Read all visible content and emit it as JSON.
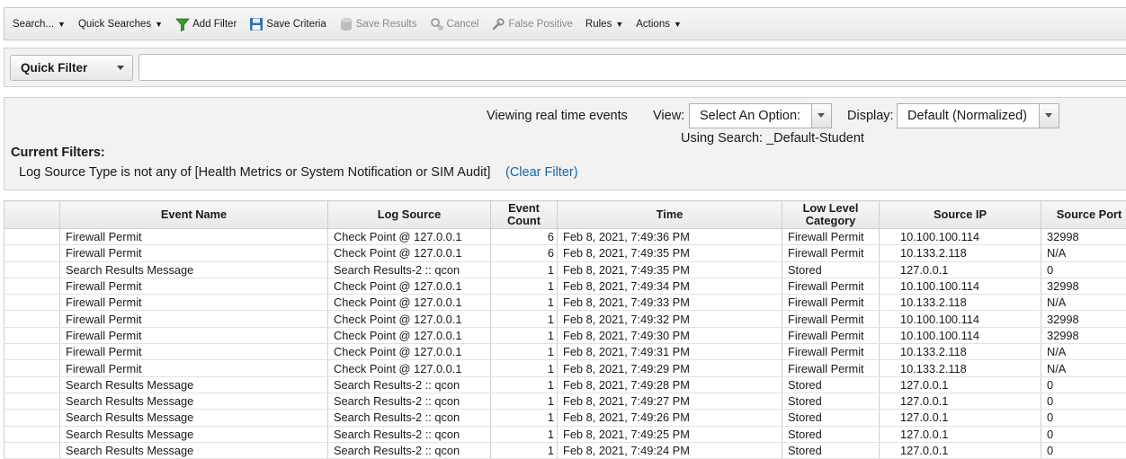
{
  "toolbar": {
    "items": [
      {
        "label": "Search...",
        "dropdown": true,
        "icon": "",
        "disabled": false
      },
      {
        "label": "Quick Searches",
        "dropdown": true,
        "icon": "",
        "disabled": false
      },
      {
        "label": "Add Filter",
        "dropdown": false,
        "icon": "funnel-icon",
        "disabled": false
      },
      {
        "label": "Save Criteria",
        "dropdown": false,
        "icon": "floppy-disk-icon",
        "disabled": false
      },
      {
        "label": "Save Results",
        "dropdown": false,
        "icon": "database-icon",
        "disabled": true
      },
      {
        "label": "Cancel",
        "dropdown": false,
        "icon": "magnifier-cancel-icon",
        "disabled": true
      },
      {
        "label": "False Positive",
        "dropdown": false,
        "icon": "wrench-icon",
        "disabled": true
      },
      {
        "label": "Rules",
        "dropdown": true,
        "icon": "",
        "disabled": false
      },
      {
        "label": "Actions",
        "dropdown": true,
        "icon": "",
        "disabled": false
      }
    ]
  },
  "quick_filter": {
    "selected": "Quick Filter",
    "input_value": ""
  },
  "info": {
    "viewing_text": "Viewing real time events",
    "view_label": "View:",
    "view_selected": "Select An Option:",
    "display_label": "Display:",
    "display_selected": "Default (Normalized)",
    "using_search": "Using Search: _Default-Student",
    "current_filters_title": "Current Filters:",
    "filter_text": "Log Source Type is not any of [Health Metrics or System Notification or SIM Audit]",
    "clear_filter_label": "(Clear Filter)"
  },
  "colors": {
    "link": "#1565a8",
    "toolbar_bg": "#efefef",
    "panel_bg": "#f2f2f2"
  },
  "grid": {
    "columns": [
      "",
      "Event Name",
      "Log Source",
      "Event Count",
      "Time",
      "Low Level Category",
      "Source IP",
      "Source Port"
    ],
    "rows": [
      [
        "",
        "Firewall Permit",
        "Check Point @ 127.0.0.1",
        "6",
        "Feb 8, 2021, 7:49:36 PM",
        "Firewall Permit",
        "10.100.100.114",
        "32998"
      ],
      [
        "",
        "Firewall Permit",
        "Check Point @ 127.0.0.1",
        "6",
        "Feb 8, 2021, 7:49:35 PM",
        "Firewall Permit",
        "10.133.2.118",
        "N/A"
      ],
      [
        "",
        "Search Results Message",
        "Search Results-2 :: qcon",
        "1",
        "Feb 8, 2021, 7:49:35 PM",
        "Stored",
        "127.0.0.1",
        "0"
      ],
      [
        "",
        "Firewall Permit",
        "Check Point @ 127.0.0.1",
        "1",
        "Feb 8, 2021, 7:49:34 PM",
        "Firewall Permit",
        "10.100.100.114",
        "32998"
      ],
      [
        "",
        "Firewall Permit",
        "Check Point @ 127.0.0.1",
        "1",
        "Feb 8, 2021, 7:49:33 PM",
        "Firewall Permit",
        "10.133.2.118",
        "N/A"
      ],
      [
        "",
        "Firewall Permit",
        "Check Point @ 127.0.0.1",
        "1",
        "Feb 8, 2021, 7:49:32 PM",
        "Firewall Permit",
        "10.100.100.114",
        "32998"
      ],
      [
        "",
        "Firewall Permit",
        "Check Point @ 127.0.0.1",
        "1",
        "Feb 8, 2021, 7:49:30 PM",
        "Firewall Permit",
        "10.100.100.114",
        "32998"
      ],
      [
        "",
        "Firewall Permit",
        "Check Point @ 127.0.0.1",
        "1",
        "Feb 8, 2021, 7:49:31 PM",
        "Firewall Permit",
        "10.133.2.118",
        "N/A"
      ],
      [
        "",
        "Firewall Permit",
        "Check Point @ 127.0.0.1",
        "1",
        "Feb 8, 2021, 7:49:29 PM",
        "Firewall Permit",
        "10.133.2.118",
        "N/A"
      ],
      [
        "",
        "Search Results Message",
        "Search Results-2 :: qcon",
        "1",
        "Feb 8, 2021, 7:49:28 PM",
        "Stored",
        "127.0.0.1",
        "0"
      ],
      [
        "",
        "Search Results Message",
        "Search Results-2 :: qcon",
        "1",
        "Feb 8, 2021, 7:49:27 PM",
        "Stored",
        "127.0.0.1",
        "0"
      ],
      [
        "",
        "Search Results Message",
        "Search Results-2 :: qcon",
        "1",
        "Feb 8, 2021, 7:49:26 PM",
        "Stored",
        "127.0.0.1",
        "0"
      ],
      [
        "",
        "Search Results Message",
        "Search Results-2 :: qcon",
        "1",
        "Feb 8, 2021, 7:49:25 PM",
        "Stored",
        "127.0.0.1",
        "0"
      ],
      [
        "",
        "Search Results Message",
        "Search Results-2 :: qcon",
        "1",
        "Feb 8, 2021, 7:49:24 PM",
        "Stored",
        "127.0.0.1",
        "0"
      ]
    ]
  }
}
